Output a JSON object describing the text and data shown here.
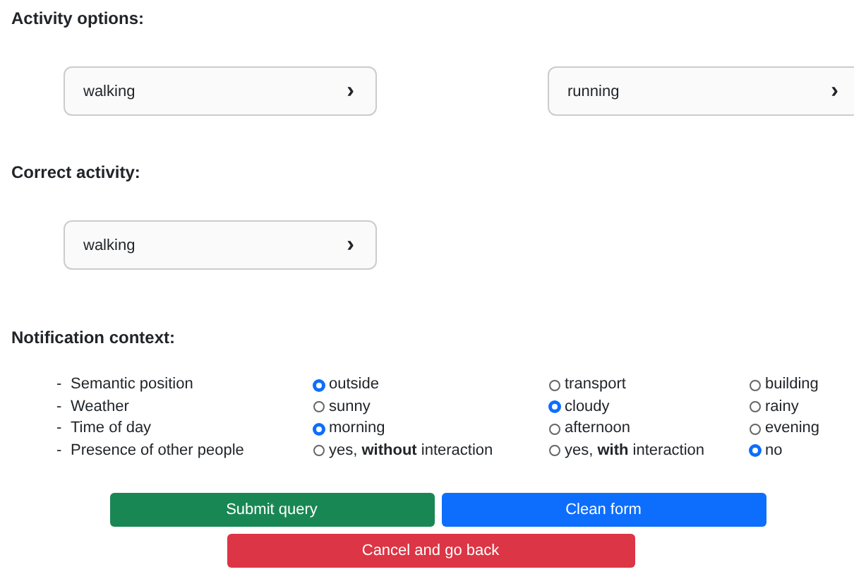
{
  "activity_options": {
    "heading": "Activity options:",
    "options": [
      {
        "label": "walking",
        "chevron": "›"
      },
      {
        "label": "running",
        "chevron": "›"
      }
    ]
  },
  "correct_activity": {
    "heading": "Correct activity:",
    "options": [
      {
        "label": "walking",
        "chevron": "›"
      }
    ]
  },
  "notification_context": {
    "heading": "Notification context:",
    "rows": [
      {
        "bullet": "-",
        "label": "Semantic position",
        "choices": [
          {
            "label": "outside",
            "selected": true
          },
          {
            "label": "transport",
            "selected": false
          },
          {
            "label": "building",
            "selected": false
          }
        ]
      },
      {
        "bullet": "-",
        "label": "Weather",
        "choices": [
          {
            "label": "sunny",
            "selected": false
          },
          {
            "label": "cloudy",
            "selected": true
          },
          {
            "label": "rainy",
            "selected": false
          }
        ]
      },
      {
        "bullet": "-",
        "label": "Time of day",
        "choices": [
          {
            "label": "morning",
            "selected": true
          },
          {
            "label": "afternoon",
            "selected": false
          },
          {
            "label": "evening",
            "selected": false
          }
        ]
      },
      {
        "bullet": "-",
        "label": "Presence of other people",
        "choices": [
          {
            "label": "yes, **without** interaction",
            "selected": false
          },
          {
            "label": "yes, **with** interaction",
            "selected": false
          },
          {
            "label": "no",
            "selected": true
          }
        ]
      }
    ]
  },
  "buttons": [
    {
      "label": "Submit query",
      "kind": "success"
    },
    {
      "label": "Clean form",
      "kind": "primary"
    },
    {
      "label": "Cancel and go back",
      "kind": "danger"
    }
  ]
}
